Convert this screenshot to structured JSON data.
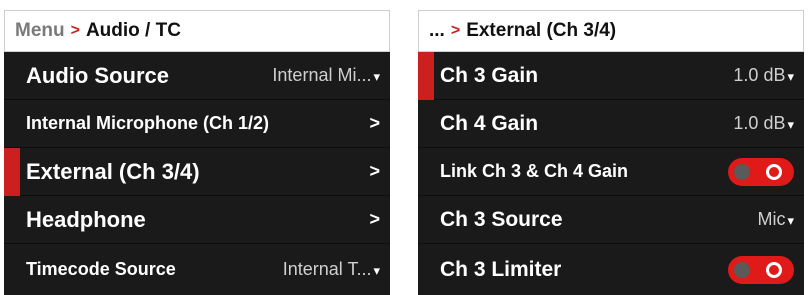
{
  "left": {
    "breadcrumb": {
      "root": "Menu",
      "separator": ">",
      "current": "Audio / TC"
    },
    "items": [
      {
        "label": "Audio Source",
        "value": "Internal Mi...",
        "indicator": "▾"
      },
      {
        "label": "Internal Microphone (Ch 1/2)",
        "indicator": ">"
      },
      {
        "label": "External (Ch 3/4)",
        "indicator": ">"
      },
      {
        "label": "Headphone",
        "indicator": ">"
      },
      {
        "label": "Timecode Source",
        "value": "Internal T...",
        "indicator": "▾"
      }
    ],
    "selected_index": 2
  },
  "right": {
    "breadcrumb": {
      "root": "...",
      "separator": ">",
      "current": "External (Ch 3/4)"
    },
    "items": [
      {
        "label": "Ch 3 Gain",
        "value": "1.0 dB",
        "indicator": "▾"
      },
      {
        "label": "Ch 4 Gain",
        "value": "1.0 dB",
        "indicator": "▾"
      },
      {
        "label": "Link Ch 3 & Ch 4 Gain",
        "toggle": "on"
      },
      {
        "label": "Ch 3 Source",
        "value": "Mic",
        "indicator": "▾"
      },
      {
        "label": "Ch 3 Limiter",
        "toggle": "on"
      }
    ],
    "selected_index": 0
  },
  "colors": {
    "accent": "#cc1f1f",
    "row_bg": "#1a1a1a",
    "toggle_on": "#e01919"
  }
}
